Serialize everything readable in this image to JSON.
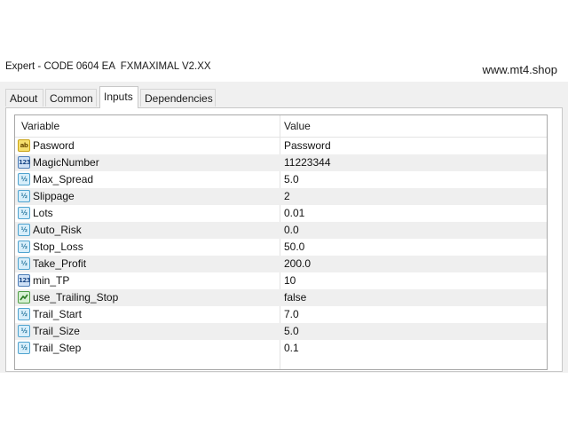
{
  "window": {
    "title": "Expert - CODE 0604 EA  FXMAXIMAL V2.XX",
    "site": "www.mt4.shop"
  },
  "tabs": [
    {
      "label": "About",
      "active": false
    },
    {
      "label": "Common",
      "active": false
    },
    {
      "label": "Inputs",
      "active": true
    },
    {
      "label": "Dependencies",
      "active": false
    }
  ],
  "grid": {
    "headers": {
      "variable": "Variable",
      "value": "Value"
    },
    "rows": [
      {
        "icon": "string-ab-icon",
        "name": "Pasword",
        "value": "Password"
      },
      {
        "icon": "integer-123-icon",
        "name": "MagicNumber",
        "value": "11223344"
      },
      {
        "icon": "double-v2-icon",
        "name": "Max_Spread",
        "value": "5.0"
      },
      {
        "icon": "double-v2-icon",
        "name": "Slippage",
        "value": "2"
      },
      {
        "icon": "double-v2-icon",
        "name": "Lots",
        "value": "0.01"
      },
      {
        "icon": "double-v2-icon",
        "name": "Auto_Risk",
        "value": "0.0"
      },
      {
        "icon": "double-v2-icon",
        "name": "Stop_Loss",
        "value": "50.0"
      },
      {
        "icon": "double-v2-icon",
        "name": "Take_Profit",
        "value": "200.0"
      },
      {
        "icon": "integer-123-icon",
        "name": "min_TP",
        "value": "10"
      },
      {
        "icon": "boolean-icon",
        "name": "use_Trailing_Stop",
        "value": "false"
      },
      {
        "icon": "double-v2-icon",
        "name": "Trail_Start",
        "value": "7.0"
      },
      {
        "icon": "double-v2-icon",
        "name": "Trail_Size",
        "value": "5.0"
      },
      {
        "icon": "double-v2-icon",
        "name": "Trail_Step",
        "value": "0.1"
      }
    ]
  },
  "colors": {
    "row_alt": "#efefef",
    "window_bg": "#f0f0f0"
  }
}
